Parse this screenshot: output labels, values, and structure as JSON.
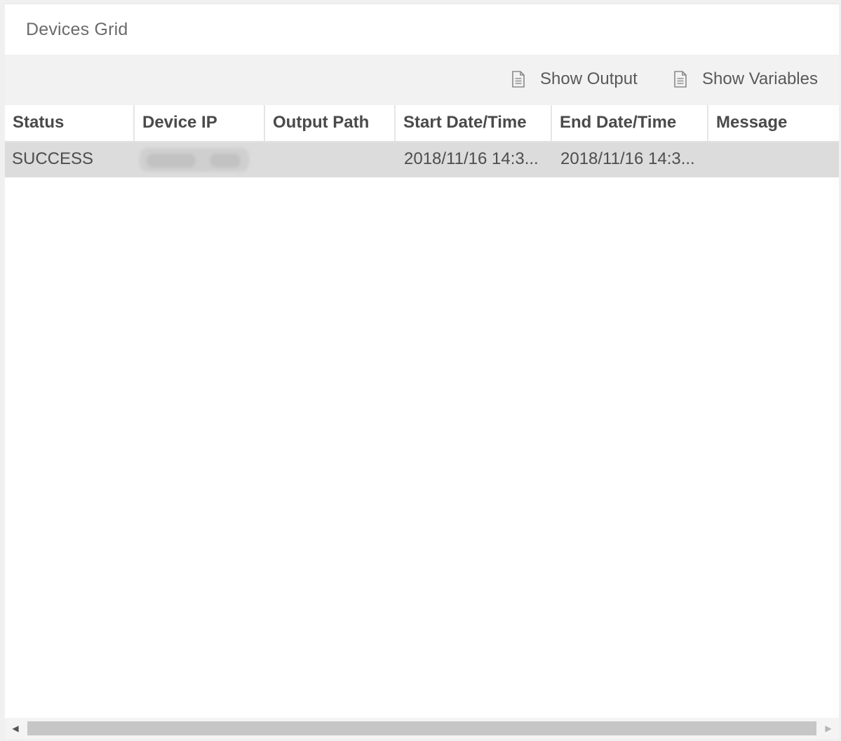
{
  "panel": {
    "title": "Devices Grid"
  },
  "toolbar": {
    "show_output_label": "Show Output",
    "show_variables_label": "Show Variables",
    "show_output_icon": "document-icon",
    "show_variables_icon": "document-icon"
  },
  "grid": {
    "columns": [
      "Status",
      "Device IP",
      "Output Path",
      "Start Date/Time",
      "End Date/Time",
      "Message"
    ],
    "rows": [
      {
        "status": "SUCCESS",
        "device_ip": "",
        "output_path": "",
        "start": "2018/11/16 14:3...",
        "end": "2018/11/16 14:3...",
        "message": ""
      }
    ]
  },
  "scrollbar": {
    "left_arrow": "◀",
    "right_arrow": "▶"
  },
  "colors": {
    "selected_row": "#dcdcdc",
    "toolbar_bg": "#f2f2f2"
  }
}
